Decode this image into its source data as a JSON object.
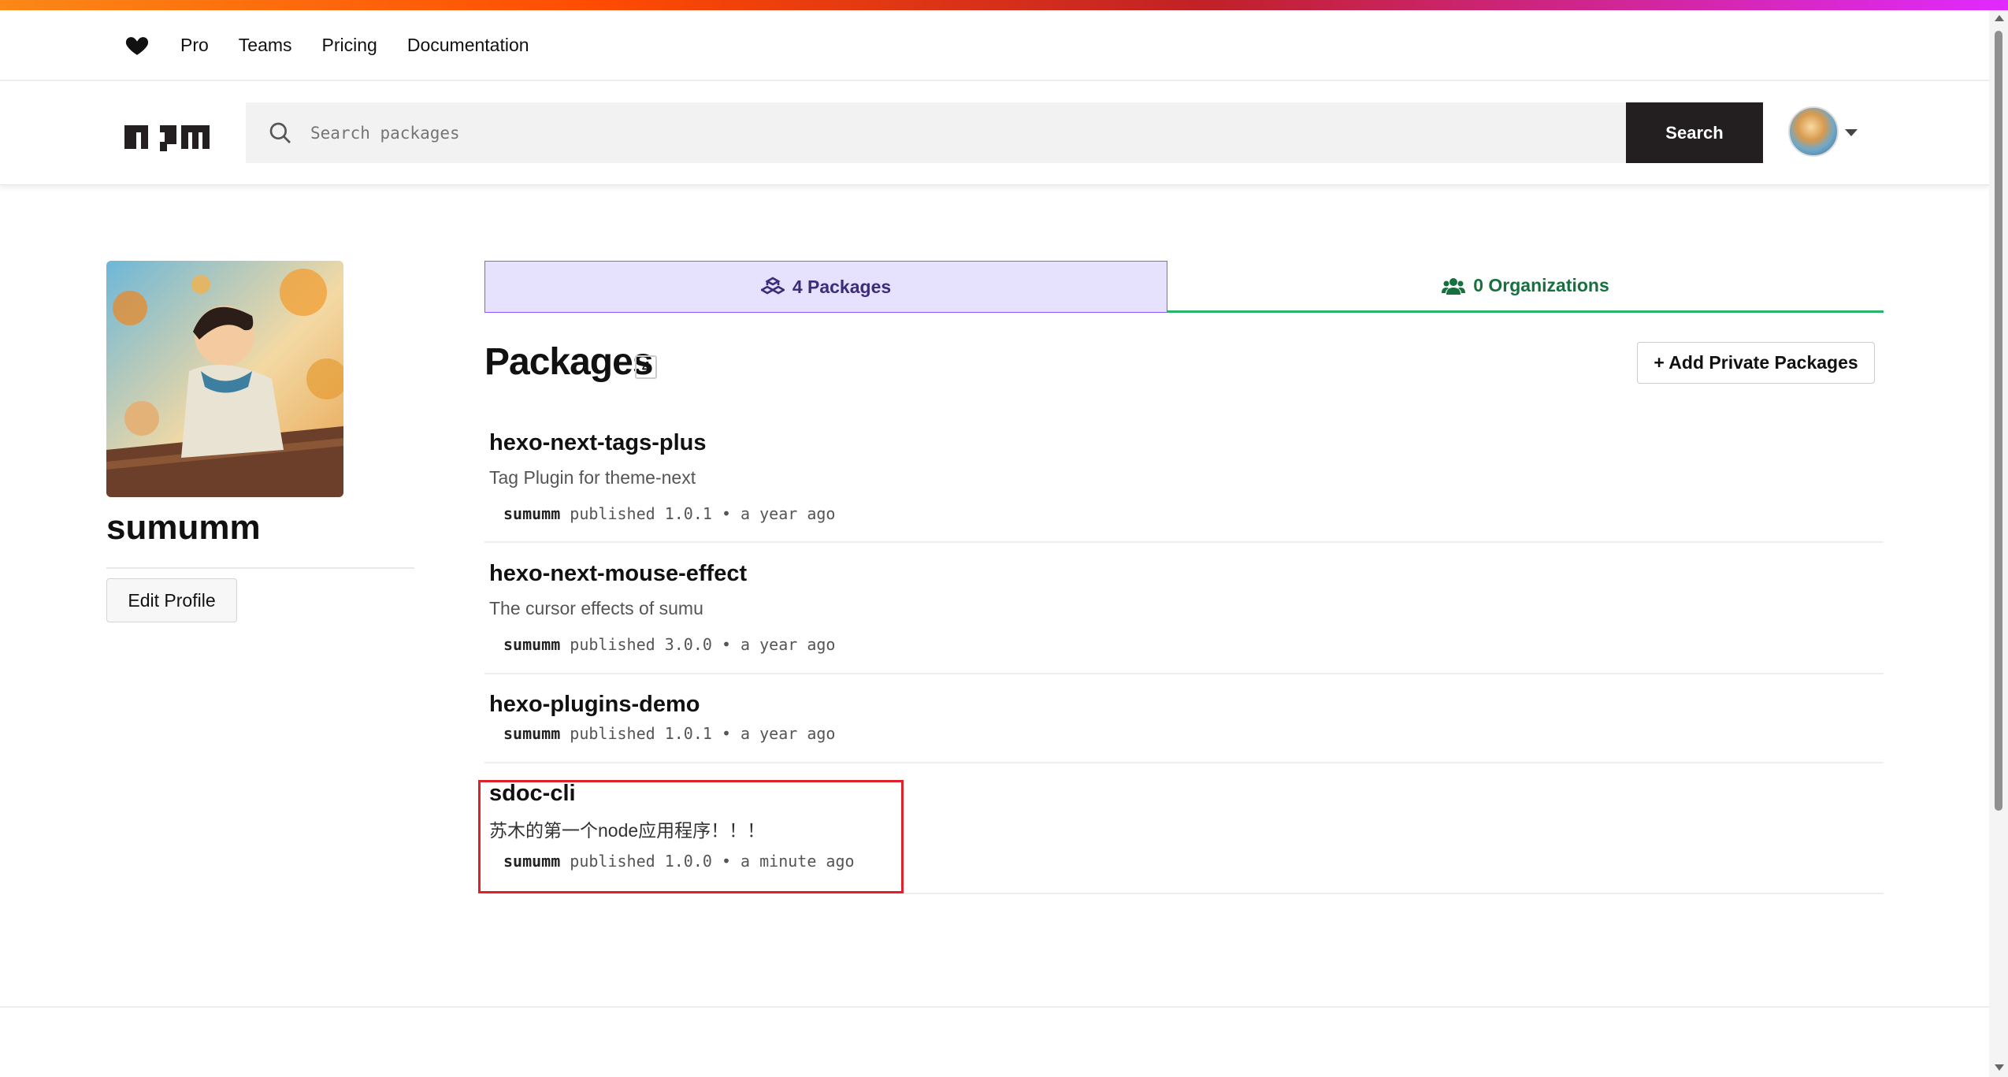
{
  "topnav": {
    "items": [
      "Pro",
      "Teams",
      "Pricing",
      "Documentation"
    ]
  },
  "header": {
    "logo_text": "npm",
    "search_placeholder": "Search packages",
    "search_button": "Search"
  },
  "profile": {
    "username": "sumumm",
    "edit_button": "Edit Profile"
  },
  "tabs": {
    "packages_label": "4 Packages",
    "organizations_label": "0 Organizations"
  },
  "packages": {
    "heading": "Packages",
    "count": "4",
    "add_private_button": "+ Add Private Packages",
    "items": [
      {
        "name": "hexo-next-tags-plus",
        "description": "Tag Plugin for theme-next",
        "publisher": "sumumm",
        "published_text": "published 1.0.1 • a year ago"
      },
      {
        "name": "hexo-next-mouse-effect",
        "description": "The cursor effects of sumu",
        "publisher": "sumumm",
        "published_text": "published 3.0.0 • a year ago"
      },
      {
        "name": "hexo-plugins-demo",
        "description": "",
        "publisher": "sumumm",
        "published_text": "published 1.0.1 • a year ago"
      },
      {
        "name": "sdoc-cli",
        "description": "苏木的第一个node应用程序！！！",
        "publisher": "sumumm",
        "published_text": "published 1.0.0 • a minute ago"
      }
    ]
  },
  "colors": {
    "accent_stripe": [
      "#fb8817",
      "#ff4b01",
      "#c12127",
      "#e02aff"
    ],
    "packages_tab_bg": "#e6e1fc",
    "organizations_tab_underline": "#2ab46a",
    "highlight_box": "#e0202a"
  }
}
